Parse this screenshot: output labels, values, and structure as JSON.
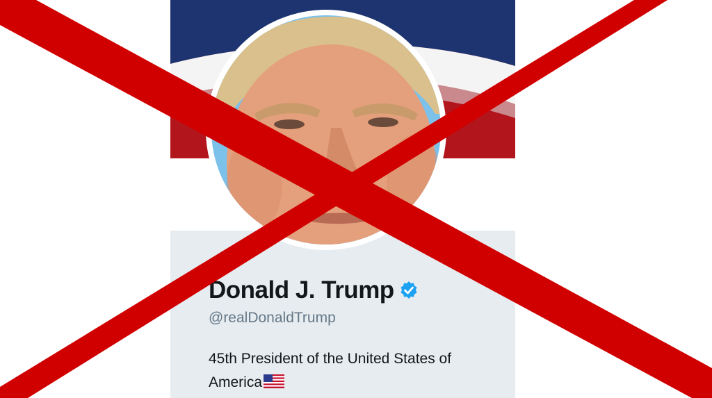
{
  "profile": {
    "display_name": "Donald J. Trump",
    "handle": "@realDonaldTrump",
    "bio_line1": "45th President of the United States of",
    "bio_line2": "America",
    "verified": true,
    "verified_icon": "verified-badge-icon",
    "flag_icon": "us-flag-icon"
  },
  "overlay": {
    "icon": "red-x-cross-icon",
    "color": "#d10000"
  },
  "colors": {
    "banner_red": "#b3151d",
    "banner_blue": "#1d3470",
    "card_background": "#e6ecf0",
    "verified_blue": "#1da1f2",
    "handle_gray": "#657786",
    "text_dark": "#14171a"
  }
}
